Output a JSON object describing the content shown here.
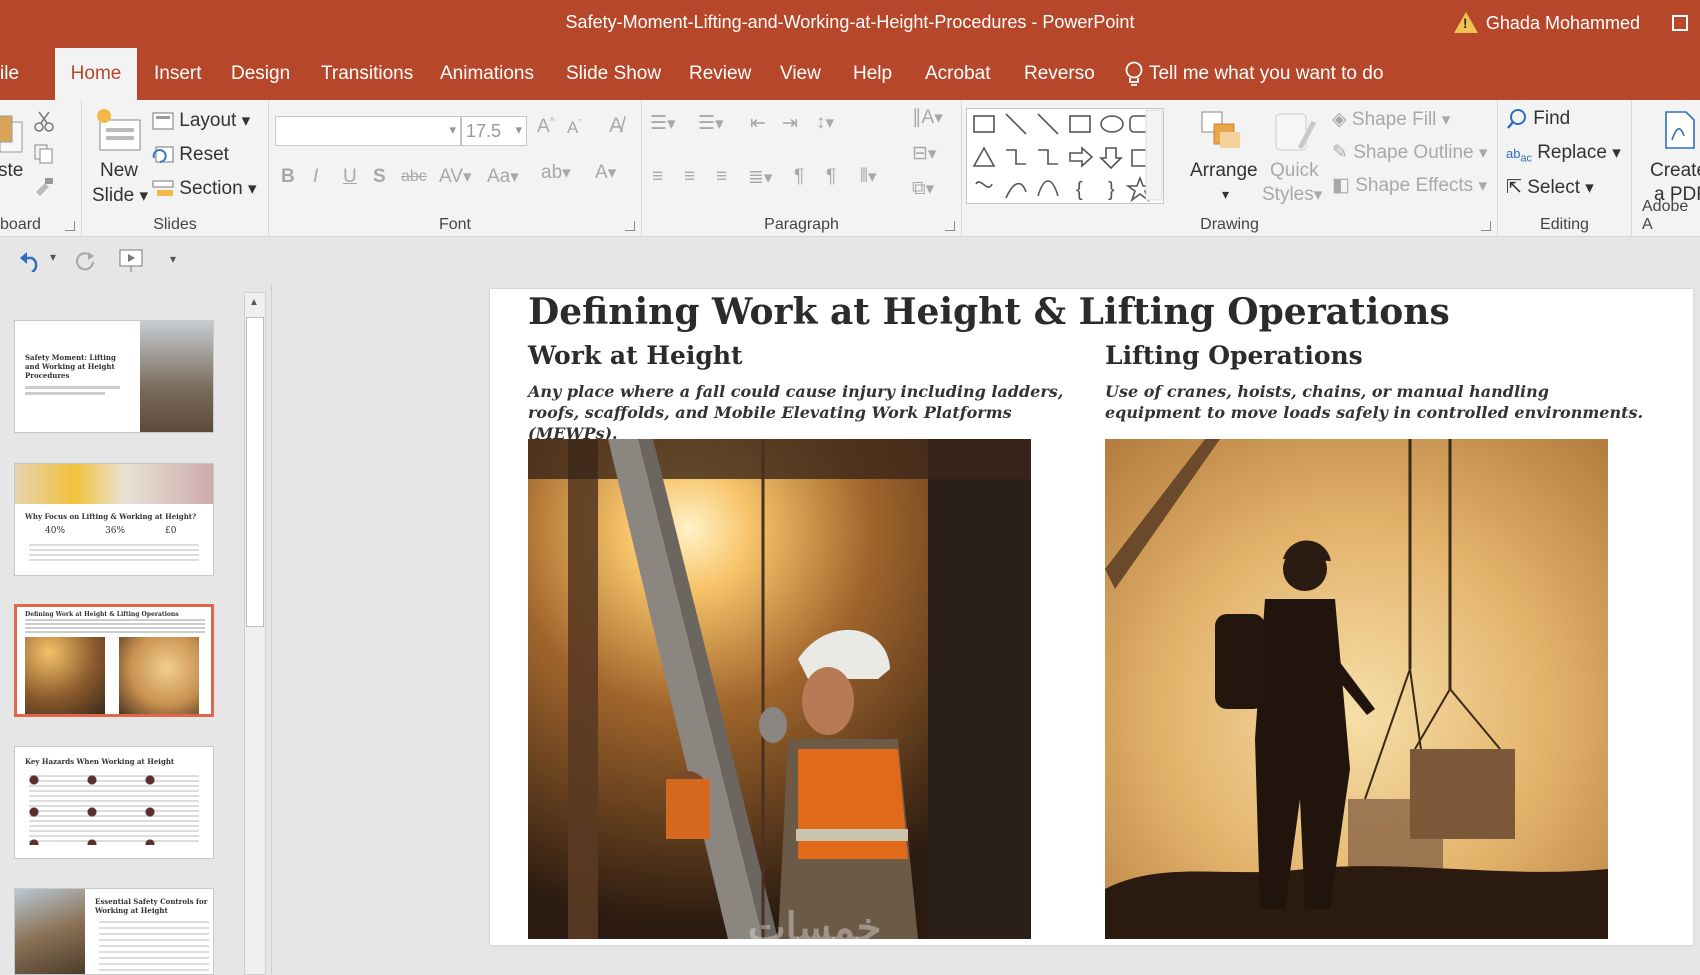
{
  "window": {
    "title": "Safety-Moment-Lifting-and-Working-at-Height-Procedures  -  PowerPoint",
    "user": "Ghada Mohammed"
  },
  "tabs": [
    "ile",
    "Home",
    "Insert",
    "Design",
    "Transitions",
    "Animations",
    "Slide Show",
    "Review",
    "View",
    "Help",
    "Acrobat",
    "Reverso"
  ],
  "tell_me": "Tell me what you want to do",
  "ribbon": {
    "clipboard": {
      "paste": "ste",
      "label": "board"
    },
    "slides": {
      "new_slide_1": "New",
      "new_slide_2": "Slide",
      "layout": "Layout",
      "reset": "Reset",
      "section": "Section",
      "label": "Slides"
    },
    "font": {
      "font_name": "",
      "font_size": "17.5",
      "label": "Font"
    },
    "paragraph": {
      "label": "Paragraph"
    },
    "drawing": {
      "arrange": "Arrange",
      "quick_styles_1": "Quick",
      "quick_styles_2": "Styles",
      "shape_fill": "Shape Fill",
      "shape_outline": "Shape Outline",
      "shape_effects": "Shape Effects",
      "label": "Drawing"
    },
    "editing": {
      "find": "Find",
      "replace": "Replace",
      "select": "Select",
      "label": "Editing"
    },
    "adobe": {
      "create_1": "Create",
      "create_2": "a PDF",
      "label": "Adobe A"
    }
  },
  "thumbnails": [
    {
      "title": "Safety Moment: Lifting and Working at Height Procedures"
    },
    {
      "title": "Why Focus on Lifting & Working at Height?",
      "stats": [
        "40%",
        "36%",
        "£0"
      ]
    },
    {
      "title": "Defining Work at Height & Lifting Operations"
    },
    {
      "title": "Key Hazards When Working at Height"
    },
    {
      "title": "Essential Safety Controls for Working at Height"
    }
  ],
  "slide": {
    "title": "Defining Work at Height & Lifting Operations",
    "left": {
      "heading": "Work at Height",
      "description": "Any place where a fall could cause injury including ladders, roofs, scaffolds, and Mobile Elevating Work Platforms (MEWPs)."
    },
    "right": {
      "heading": "Lifting Operations",
      "description": "Use of cranes, hoists, chains, or manual handling equipment to move loads safely in controlled environments."
    }
  },
  "watermark": "خمسات",
  "colors": {
    "accent": "#b7472a",
    "selected_thumb": "#e0674a",
    "ribbon_bg": "#f3f3f3"
  }
}
